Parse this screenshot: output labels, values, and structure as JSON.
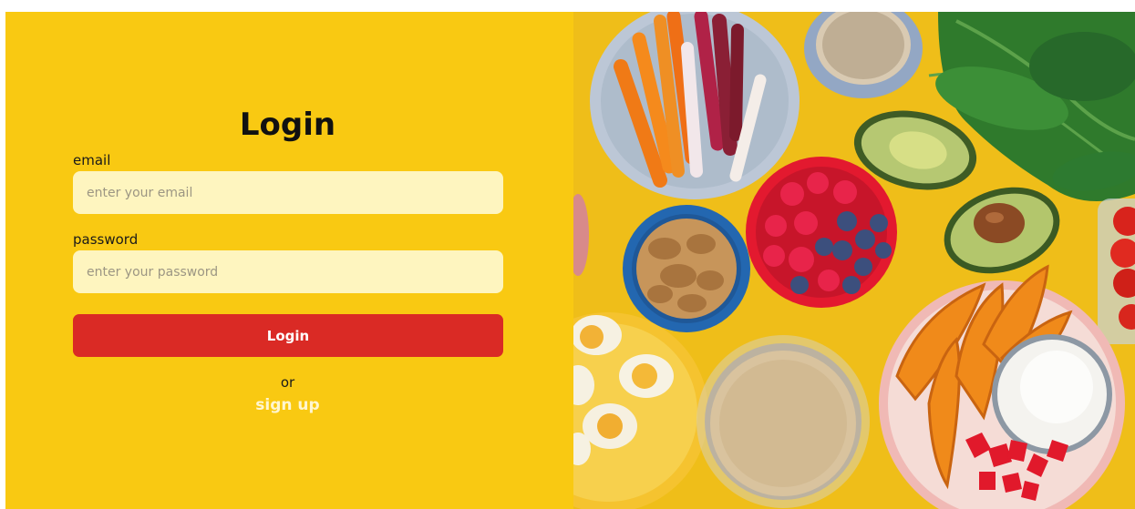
{
  "login": {
    "title": "Login",
    "email_label": "email",
    "email_placeholder": "enter your email",
    "password_label": "password",
    "password_placeholder": "enter your password",
    "button_label": "Login",
    "or_text": "or",
    "signup_label": "sign up"
  },
  "colors": {
    "panel_bg": "#f9c912",
    "input_bg": "#fef5bf",
    "button_bg": "#da2a25",
    "signup_text": "#fff6d0"
  },
  "hero_image": {
    "icon": "food-bowls-photo"
  }
}
